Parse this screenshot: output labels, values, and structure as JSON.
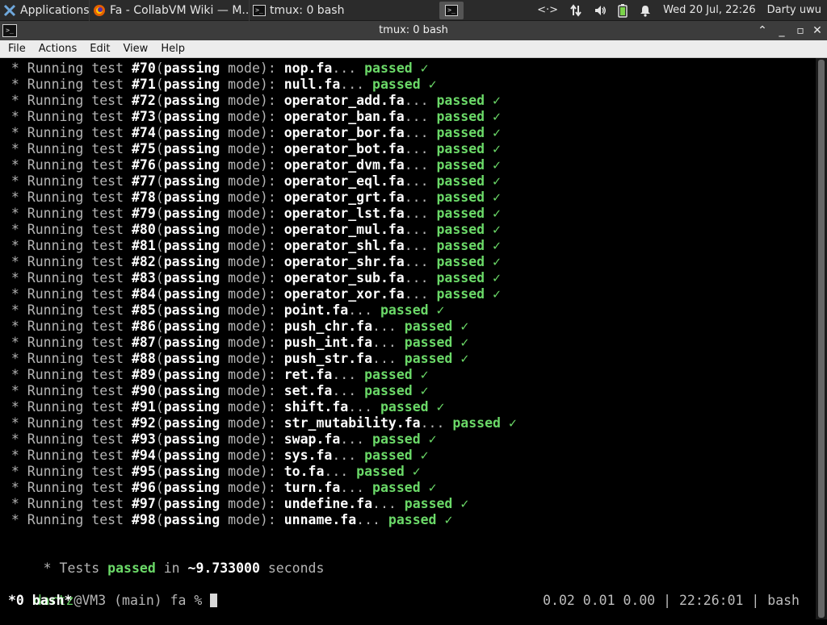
{
  "panel": {
    "applications_label": "Applications",
    "tasks": [
      {
        "label": "Fa - CollabVM Wiki — M...",
        "icon": "firefox-icon"
      },
      {
        "label": "tmux: 0 bash",
        "icon": "terminal-icon"
      }
    ],
    "tray": {
      "network": "<·>",
      "clock": "Wed 20 Jul, 22:26",
      "user": "Darty uwu"
    }
  },
  "window": {
    "title": "tmux: 0 bash"
  },
  "menu": [
    "File",
    "Actions",
    "Edit",
    "View",
    "Help"
  ],
  "terminal": {
    "tests": [
      {
        "num": "#70",
        "file": "nop.fa"
      },
      {
        "num": "#71",
        "file": "null.fa"
      },
      {
        "num": "#72",
        "file": "operator_add.fa"
      },
      {
        "num": "#73",
        "file": "operator_ban.fa"
      },
      {
        "num": "#74",
        "file": "operator_bor.fa"
      },
      {
        "num": "#75",
        "file": "operator_bot.fa"
      },
      {
        "num": "#76",
        "file": "operator_dvm.fa"
      },
      {
        "num": "#77",
        "file": "operator_eql.fa"
      },
      {
        "num": "#78",
        "file": "operator_grt.fa"
      },
      {
        "num": "#79",
        "file": "operator_lst.fa"
      },
      {
        "num": "#80",
        "file": "operator_mul.fa"
      },
      {
        "num": "#81",
        "file": "operator_shl.fa"
      },
      {
        "num": "#82",
        "file": "operator_shr.fa"
      },
      {
        "num": "#83",
        "file": "operator_sub.fa"
      },
      {
        "num": "#84",
        "file": "operator_xor.fa"
      },
      {
        "num": "#85",
        "file": "point.fa"
      },
      {
        "num": "#86",
        "file": "push_chr.fa"
      },
      {
        "num": "#87",
        "file": "push_int.fa"
      },
      {
        "num": "#88",
        "file": "push_str.fa"
      },
      {
        "num": "#89",
        "file": "ret.fa"
      },
      {
        "num": "#90",
        "file": "set.fa"
      },
      {
        "num": "#91",
        "file": "shift.fa"
      },
      {
        "num": "#92",
        "file": "str_mutability.fa"
      },
      {
        "num": "#93",
        "file": "swap.fa"
      },
      {
        "num": "#94",
        "file": "sys.fa"
      },
      {
        "num": "#95",
        "file": "to.fa"
      },
      {
        "num": "#96",
        "file": "turn.fa"
      },
      {
        "num": "#97",
        "file": "undefine.fa"
      },
      {
        "num": "#98",
        "file": "unname.fa"
      }
    ],
    "line_prefix": " * Running test ",
    "mode_open": "(",
    "mode_word": "passing",
    "mode_close": " mode): ",
    "ellipsis": "... ",
    "passed": "passed",
    "check": "✓",
    "summary_prefix": " * Tests ",
    "summary_passed": "passed",
    "summary_in": " in ",
    "summary_time": "~9.733000",
    "summary_suffix": " seconds",
    "prompt_user": "dartz",
    "prompt_rest": "@VM3 (main) fa % "
  },
  "status": {
    "left": "*0 bash*",
    "right": "0.02 0.01 0.00 | 22:26:01 | bash"
  }
}
